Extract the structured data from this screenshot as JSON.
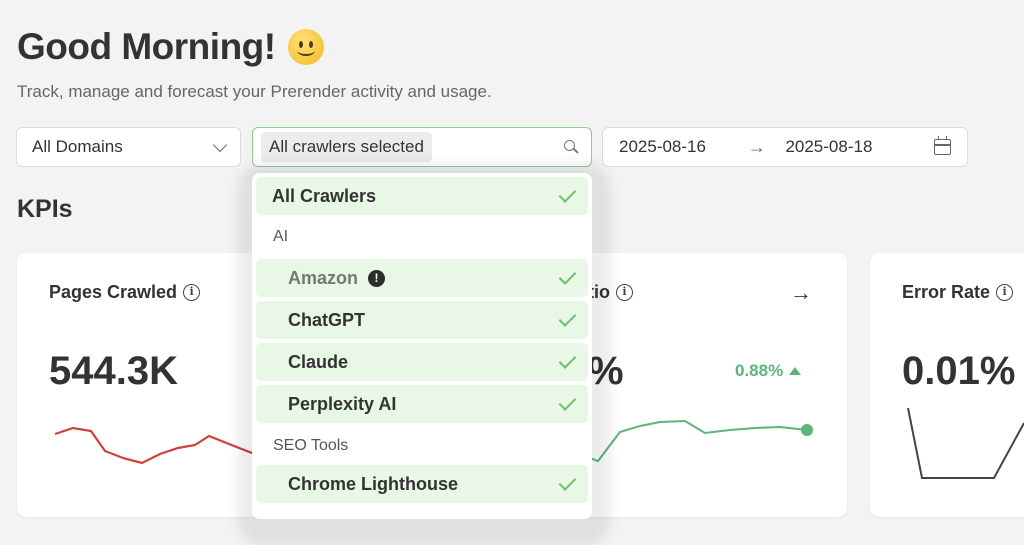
{
  "header": {
    "greeting": "Good Morning!",
    "subtitle": "Track, manage and forecast your Prerender activity and usage."
  },
  "filters": {
    "domains": "All Domains",
    "crawlers_chip": "All crawlers selected",
    "date_from": "2025-08-16",
    "date_to": "2025-08-18",
    "date_arrow": "→"
  },
  "kpis": {
    "heading": "KPIs",
    "cards": [
      {
        "title": "Pages Crawled",
        "value": "544.3K"
      },
      {
        "title": "tio",
        "value": "%",
        "trend": "0.88%"
      },
      {
        "title": "Error Rate",
        "value": "0.01%"
      }
    ]
  },
  "dropdown": {
    "all": "All Crawlers",
    "groups": [
      {
        "name": "AI",
        "items": [
          "Amazon",
          "ChatGPT",
          "Claude",
          "Perplexity AI"
        ]
      },
      {
        "name": "SEO Tools",
        "items": [
          "Chrome Lighthouse"
        ]
      }
    ]
  },
  "colors": {
    "accent_green": "#5ab57a",
    "selected_bg": "#e9f7e6",
    "red_line": "#d0403a"
  }
}
